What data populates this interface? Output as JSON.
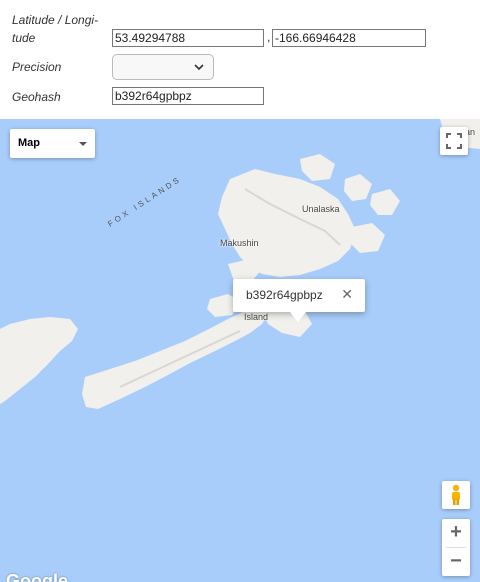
{
  "form": {
    "latlng_label": "Latitude / Longi-tude",
    "latlng_label_line1": "Latitude / Longi-",
    "latlng_label_line2": "tude",
    "latitude_value": "53.49294788",
    "separator": ",",
    "longitude_value": "-166.66946428",
    "precision_label": "Precision",
    "precision_value": "",
    "geohash_label": "Geohash",
    "geohash_value": "b392r64gpbpz"
  },
  "map": {
    "type_control_label": "Map",
    "region_label": "FOX ISLANDS",
    "places": {
      "unalaska": "Unalaska",
      "makushin": "Makushin",
      "island": "Island",
      "partial_right": "an"
    },
    "info_window_title": "b392r64gpbpz",
    "zoom_in": "+",
    "zoom_out": "−",
    "logo_partial": "Google",
    "colors": {
      "water": "#a9cdfb",
      "land": "#f2f1ef"
    }
  }
}
